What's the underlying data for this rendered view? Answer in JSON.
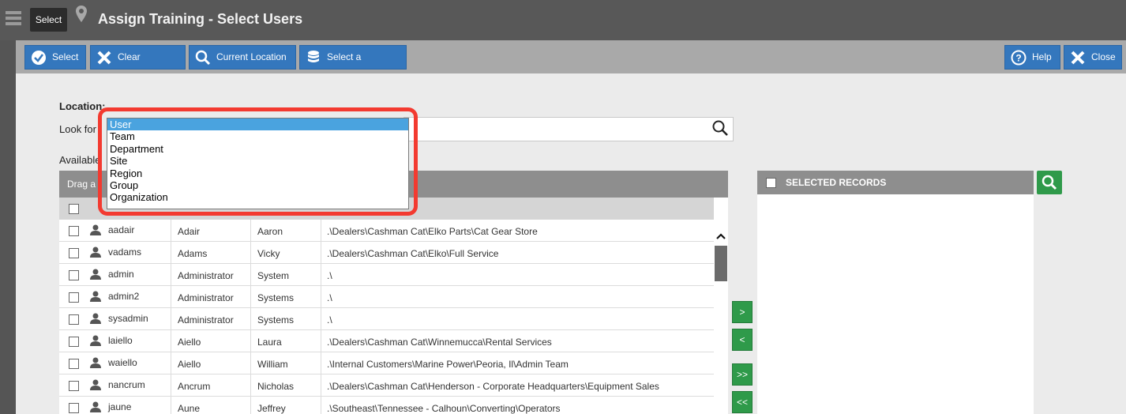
{
  "header": {
    "select_label": "Select",
    "title": "Assign Training - Select Users"
  },
  "toolbar": {
    "select": "Select",
    "clear_selected": "Clear Selected",
    "current_location": "Current Location",
    "select_location": "Select a Location",
    "help": "Help",
    "close": "Close"
  },
  "form": {
    "location_label": "Location:",
    "look_for_label": "Look for",
    "available_label": "Available",
    "search_value": ""
  },
  "dropdown": {
    "options": [
      "User",
      "Team",
      "Department",
      "Site",
      "Region",
      "Group",
      "Organization"
    ],
    "selected": "User"
  },
  "grid": {
    "group_hint": "Drag a",
    "rows": [
      {
        "username": "aadair",
        "last": "Adair",
        "first": "Aaron",
        "location": ".\\Dealers\\Cashman Cat\\Elko Parts\\Cat Gear Store"
      },
      {
        "username": "vadams",
        "last": "Adams",
        "first": "Vicky",
        "location": ".\\Dealers\\Cashman Cat\\Elko\\Full Service"
      },
      {
        "username": "admin",
        "last": "Administrator",
        "first": "System",
        "location": ".\\"
      },
      {
        "username": "admin2",
        "last": "Administrator",
        "first": "Systems",
        "location": ".\\"
      },
      {
        "username": "sysadmin",
        "last": "Administrator",
        "first": "Systems",
        "location": ".\\"
      },
      {
        "username": "laiello",
        "last": "Aiello",
        "first": "Laura",
        "location": ".\\Dealers\\Cashman Cat\\Winnemucca\\Rental Services"
      },
      {
        "username": "waiello",
        "last": "Aiello",
        "first": "William",
        "location": ".\\Internal Customers\\Marine Power\\Peoria, Il\\Admin Team"
      },
      {
        "username": "nancrum",
        "last": "Ancrum",
        "first": "Nicholas",
        "location": ".\\Dealers\\Cashman Cat\\Henderson - Corporate Headquarters\\Equipment Sales"
      },
      {
        "username": "jaune",
        "last": "Aune",
        "first": "Jeffrey",
        "location": ".\\Southeast\\Tennessee - Calhoun\\Converting\\Operators"
      }
    ]
  },
  "transfer": {
    "add": ">",
    "remove": "<",
    "add_all": ">>",
    "remove_all": "<<"
  },
  "selected": {
    "header": "SELECTED RECORDS"
  },
  "colors": {
    "blue_button": "#3477bd",
    "green_button": "#2f9a4a",
    "highlight": "#f33a30"
  }
}
